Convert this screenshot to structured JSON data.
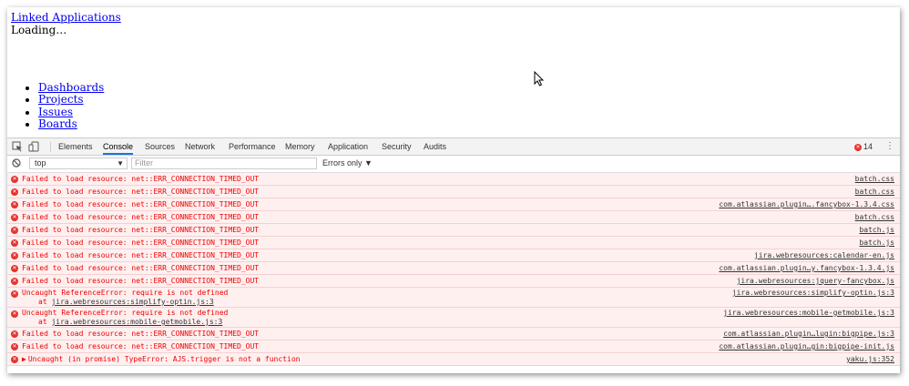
{
  "page": {
    "title_link": "Linked Applications",
    "loading_text": "Loading…",
    "nav_items": [
      "Dashboards",
      "Projects",
      "Issues",
      "Boards"
    ]
  },
  "devtools": {
    "tabs": [
      "Elements",
      "Console",
      "Sources",
      "Network",
      "Performance",
      "Memory",
      "Application",
      "Security",
      "Audits"
    ],
    "active_tab": "Console",
    "error_count": "14",
    "context": "top",
    "filter_placeholder": "Filter",
    "level": "Errors only"
  },
  "console": {
    "rows": [
      {
        "msg": "Failed to load resource: net::ERR_CONNECTION_TIMED_OUT",
        "src": "batch.css"
      },
      {
        "msg": "Failed to load resource: net::ERR_CONNECTION_TIMED_OUT",
        "src": "batch.css"
      },
      {
        "msg": "Failed to load resource: net::ERR_CONNECTION_TIMED_OUT",
        "src": "com.atlassian.plugin….fancybox-1.3.4.css"
      },
      {
        "msg": "Failed to load resource: net::ERR_CONNECTION_TIMED_OUT",
        "src": "batch.css"
      },
      {
        "msg": "Failed to load resource: net::ERR_CONNECTION_TIMED_OUT",
        "src": "batch.js"
      },
      {
        "msg": "Failed to load resource: net::ERR_CONNECTION_TIMED_OUT",
        "src": "batch.js"
      },
      {
        "msg": "Failed to load resource: net::ERR_CONNECTION_TIMED_OUT",
        "src": "jira.webresources:calendar-en.js"
      },
      {
        "msg": "Failed to load resource: net::ERR_CONNECTION_TIMED_OUT",
        "src": "com.atlassian.plugin…y.fancybox-1.3.4.js"
      },
      {
        "msg": "Failed to load resource: net::ERR_CONNECTION_TIMED_OUT",
        "src": "jira.webresources:jquery-fancybox.js"
      }
    ],
    "ref_errors": [
      {
        "msg": "Uncaught ReferenceError: require is not defined",
        "at": "at ",
        "at_src": "jira.webresources:simplify-optin.js:3",
        "src": "jira.webresources:simplify-optin.js:3"
      },
      {
        "msg": "Uncaught ReferenceError: require is not defined",
        "at": "at ",
        "at_src": "jira.webresources:mobile-getmobile.js:3",
        "src": "jira.webresources:mobile-getmobile.js:3"
      }
    ],
    "rows_after": [
      {
        "msg": "Failed to load resource: net::ERR_CONNECTION_TIMED_OUT",
        "src": "com.atlassian.plugin…lugin:bigpipe.js:3"
      },
      {
        "msg": "Failed to load resource: net::ERR_CONNECTION_TIMED_OUT",
        "src": "com.atlassian.plugin…gin:bigpipe-init.js"
      }
    ],
    "promise_error": {
      "msg": "Uncaught (in promise) TypeError: AJS.trigger is not a function",
      "src": "yaku.js:352"
    }
  }
}
